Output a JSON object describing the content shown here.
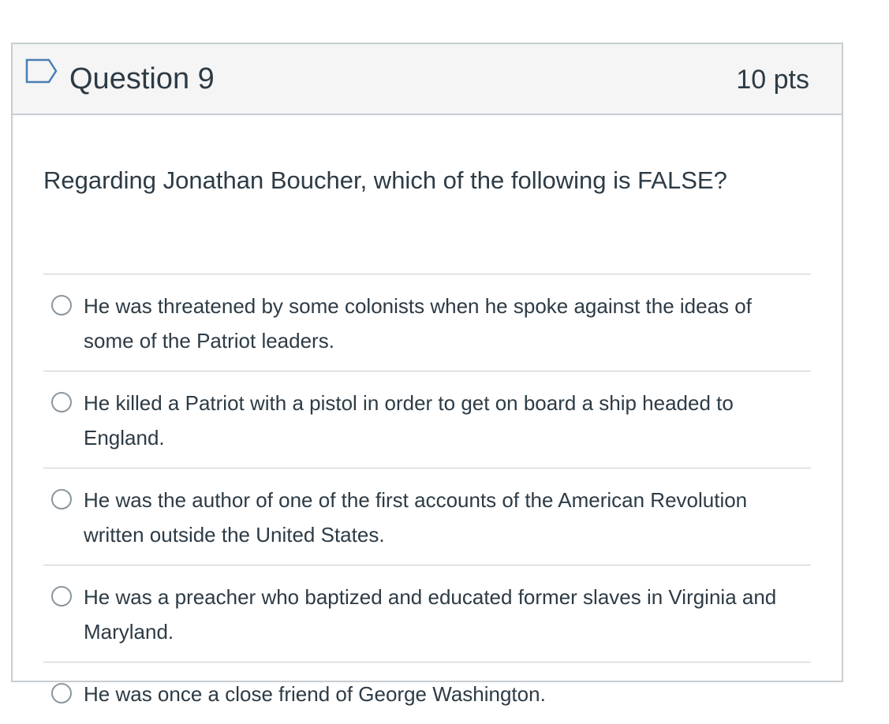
{
  "question": {
    "title": "Question 9",
    "points": "10 pts",
    "flag_icon": "flag-icon",
    "text": "Regarding Jonathan Boucher, which of the following is FALSE?",
    "answers": [
      {
        "label": "He was threatened by some colonists when he spoke against the ideas of some of the Patriot leaders."
      },
      {
        "label": "He killed a Patriot with a pistol in order to get on board a ship headed to England."
      },
      {
        "label": "He was the author of one of the first accounts of the American Revolution written outside the United States."
      },
      {
        "label": "He was a preacher who baptized and educated former slaves in Virginia and Maryland."
      },
      {
        "label": "He was once a close friend of George Washington."
      }
    ]
  },
  "colors": {
    "border": "#c7cdd1",
    "header_bg": "#f5f5f5",
    "text": "#2d3b45",
    "flag": "#4a7fb5"
  }
}
